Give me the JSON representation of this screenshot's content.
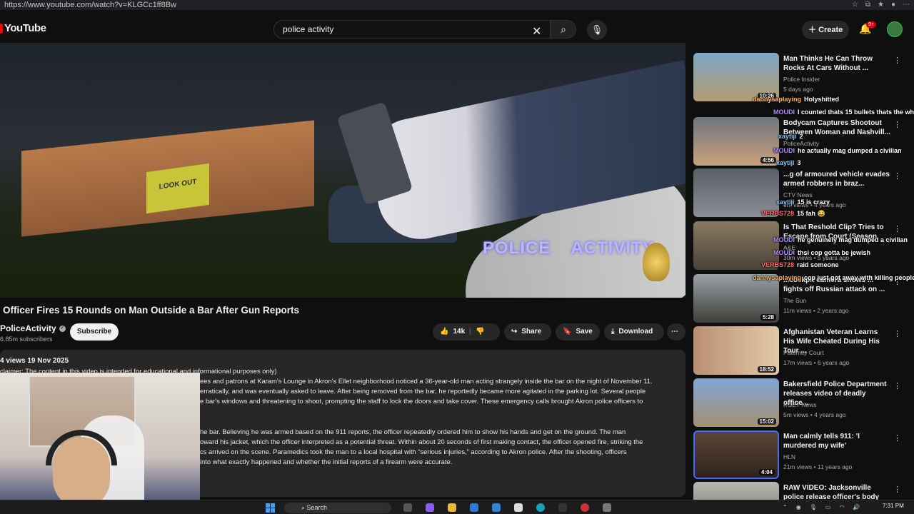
{
  "browser": {
    "url": "https://www.youtube.com/watch?v=KLGCc1ff8Bw"
  },
  "header": {
    "logo": "YouTube",
    "search_value": "police activity",
    "create_label": "Create",
    "notif_count": "9+"
  },
  "video": {
    "watermark_left": "POLICE",
    "watermark_right": "ACTIVITY",
    "sign_text": "LOOK OUT",
    "title": "Officer Fires 15 Rounds on Man Outside a Bar After Gun Reports",
    "channel": "PoliceActivity",
    "subscribers": "6.85m subscribers",
    "subscribe_label": "Subscribe",
    "likes": "14k",
    "share_label": "Share",
    "save_label": "Save",
    "download_label": "Download"
  },
  "description": {
    "meta": "4 views  19 Nov 2025",
    "lines": [
      "claimer: The content in this video is intended for educational and informational purposes only)",
      "ees and patrons at Karam's Lounge in Akron's Ellet neighborhood noticed a 36-year-old man acting strangely inside the bar on the night of November 11.",
      "erratically, and was eventually asked to leave. After being removed from the bar, he reportedly became more agitated in the parking lot. Several people",
      "e bar's windows and threatening to shoot, prompting the staff to lock the doors and take cover. These emergency calls brought Akron police officers to",
      "he bar. Believing he was armed based on the 911 reports, the officer repeatedly ordered him to show his hands and get on the ground. The man",
      "oward his jacket, which the officer interpreted as a potential threat. Within about 20 seconds of first making contact, the officer opened fire, striking the",
      "cs arrived on the scene. Paramedics took the man to a local hospital with “serious injuries,” according to Akron police. After the shooting, officers",
      "into what exactly happened and whether the initial reports of a firearm were accurate."
    ]
  },
  "recommendations": [
    {
      "title": "Man Thinks He Can Throw Rocks At Cars Without ...",
      "channel": "Police Insider",
      "meta": "5 days ago",
      "duration": "10:26"
    },
    {
      "title": "Bodycam Captures Shootout Between Woman and Nashvill...",
      "channel": "PoliceActivity",
      "meta": "",
      "duration": "4:56"
    },
    {
      "title": "...g of armoured vehicle evades armed robbers in braz...",
      "channel": "CTV News",
      "meta": "9m views • 4 years ago",
      "duration": ""
    },
    {
      "title": "Is That Reshold Clip? Tries to Escape from Court (Season",
      "channel": "A&E",
      "meta": "30m views • 5 years ago",
      "duration": ""
    },
    {
      "title": "...cockpit camera shows ... fights off Russian attack on ...",
      "channel": "The Sun",
      "meta": "11m views • 2 years ago",
      "duration": "5:28"
    },
    {
      "title": "Afghanistan Veteran Learns His Wife Cheated During His Tour ...",
      "channel": "Paternity Court",
      "meta": "17m views • 6 years ago",
      "duration": "18:52"
    },
    {
      "title": "Bakersfield Police Department releases video of deadly office...",
      "channel": "KGET News",
      "meta": "5m views • 4 years ago",
      "duration": "15:02"
    },
    {
      "title": "Man calmly tells 911: 'I murdered my wife'",
      "channel": "HLN",
      "meta": "21m views • 11 years ago",
      "duration": "4:04"
    },
    {
      "title": "RAW VIDEO: Jacksonville police release officer's body camera",
      "channel": "",
      "meta": "",
      "duration": ""
    }
  ],
  "chat": [
    {
      "user": "dannysaplaying",
      "msg": "Holyshitted",
      "color": "#ffb347"
    },
    {
      "user": "MOUDI",
      "msg": "I counted thats 15 bullets thats the wh",
      "color": "#b388ff"
    },
    {
      "user": "xaytiji",
      "msg": "2",
      "color": "#7ec8ff"
    },
    {
      "user": "MOUDI",
      "msg": "he actually mag dumped a civilian",
      "color": "#b388ff"
    },
    {
      "user": "xaytiji",
      "msg": "3",
      "color": "#7ec8ff"
    },
    {
      "user": "xaytiji",
      "msg": "15 is crazy",
      "color": "#7ec8ff"
    },
    {
      "user": "VERBS728",
      "msg": "15 fah 😂",
      "color": "#ff6b6b"
    },
    {
      "user": "MOUDI",
      "msg": "he genuinely mag dumped a civilian",
      "color": "#b388ff"
    },
    {
      "user": "MOUDI",
      "msg": "thsi cop gotta be jewish",
      "color": "#b388ff"
    },
    {
      "user": "VERBS728",
      "msg": "raid someone",
      "color": "#ff6b6b"
    },
    {
      "user": "dannysaplaying",
      "msg": "cop just got away with killing people",
      "color": "#ffb347"
    }
  ],
  "taskbar": {
    "search_label": "Search",
    "time": "7:31 PM"
  }
}
